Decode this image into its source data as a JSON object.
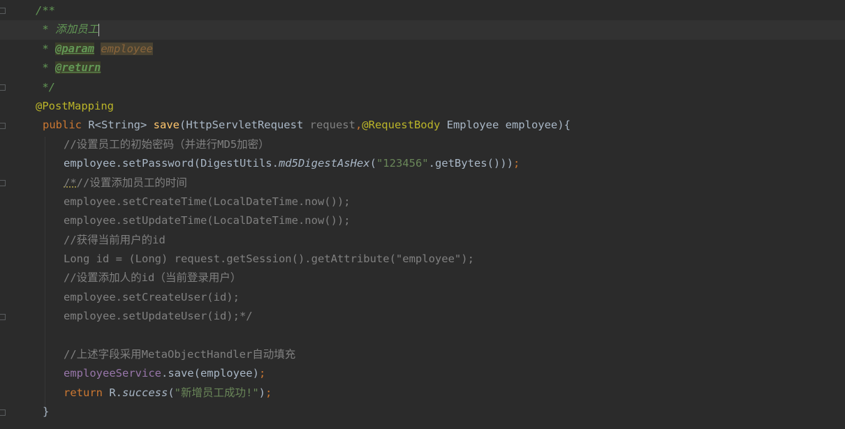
{
  "editor": {
    "lines": [
      [
        {
          "t": "/**",
          "c": "c-doc"
        }
      ],
      [
        {
          "t": " * ",
          "c": "c-doc"
        },
        {
          "t": "添加员工",
          "c": "c-doc"
        }
      ],
      [
        {
          "t": " * ",
          "c": "c-doc"
        },
        {
          "t": "@param",
          "c": "c-doctag"
        },
        {
          "t": " ",
          "c": "c-doc"
        },
        {
          "t": "employee",
          "c": "c-param"
        }
      ],
      [
        {
          "t": " * ",
          "c": "c-doc"
        },
        {
          "t": "@return",
          "c": "c-doctag"
        }
      ],
      [
        {
          "t": " */",
          "c": "c-doc"
        }
      ],
      [
        {
          "t": "@PostMapping",
          "c": "c-ann"
        }
      ],
      [
        {
          "t": "public ",
          "c": "c-kw"
        },
        {
          "t": "R<String> "
        },
        {
          "t": "save",
          "c": "c-fn"
        },
        {
          "t": "(HttpServletRequest "
        },
        {
          "t": "request",
          "c": "c-grey"
        },
        {
          "t": ",",
          "c": "c-kw"
        },
        {
          "t": "@RequestBody ",
          "c": "c-ann"
        },
        {
          "t": "Employee employee){"
        }
      ],
      [
        {
          "t": "//设置员工的初始密码（并进行MD5加密）",
          "c": "c-cmt"
        }
      ],
      [
        {
          "t": "employee.setPassword(DigestUtils."
        },
        {
          "t": "md5DigestAsHex",
          "c": "c-it"
        },
        {
          "t": "("
        },
        {
          "t": "\"123456\"",
          "c": "c-str"
        },
        {
          "t": ".getBytes()))"
        },
        {
          "t": ";",
          "c": "c-kw"
        }
      ],
      [
        {
          "t": "/*",
          "c": "c-cmt c-warn"
        },
        {
          "t": "//设置添加员工的时间",
          "c": "c-cmt"
        }
      ],
      [
        {
          "t": "employee.setCreateTime(LocalDateTime.now());",
          "c": "c-cmt"
        }
      ],
      [
        {
          "t": "employee.setUpdateTime(LocalDateTime.now());",
          "c": "c-cmt"
        }
      ],
      [
        {
          "t": "//获得当前用户的id",
          "c": "c-cmt"
        }
      ],
      [
        {
          "t": "Long id = (Long) request.getSession().getAttribute(\"employee\");",
          "c": "c-cmt"
        }
      ],
      [
        {
          "t": "//设置添加人的id（当前登录用户）",
          "c": "c-cmt"
        }
      ],
      [
        {
          "t": "employee.setCreateUser(id);",
          "c": "c-cmt"
        }
      ],
      [
        {
          "t": "employee.setUpdateUser(id);*/",
          "c": "c-cmt"
        }
      ],
      [],
      [
        {
          "t": "//上述字段采用MetaObjectHandler自动填充",
          "c": "c-cmt"
        }
      ],
      [
        {
          "t": "employeeService",
          "c": "c-field"
        },
        {
          "t": ".save(employee)"
        },
        {
          "t": ";",
          "c": "c-kw"
        }
      ],
      [
        {
          "t": "return ",
          "c": "c-kw"
        },
        {
          "t": "R."
        },
        {
          "t": "success",
          "c": "c-it"
        },
        {
          "t": "("
        },
        {
          "t": "\"新增员工成功!\"",
          "c": "c-str"
        },
        {
          "t": ")"
        },
        {
          "t": ";",
          "c": "c-kw"
        }
      ],
      [
        {
          "t": "}"
        }
      ]
    ],
    "indents": [
      51,
      51,
      51,
      51,
      51,
      51,
      61,
      91,
      91,
      91,
      91,
      91,
      91,
      91,
      91,
      91,
      91,
      91,
      91,
      91,
      91,
      61
    ],
    "current_line": 1,
    "caret_line": 1,
    "bulb_line": 1
  },
  "icons": {
    "bulb": "lightbulb-icon",
    "fold": "fold-marker-icon"
  },
  "colors": {
    "background": "#2b2b2b",
    "current_line": "#323232",
    "bulb": "#f0c040"
  }
}
